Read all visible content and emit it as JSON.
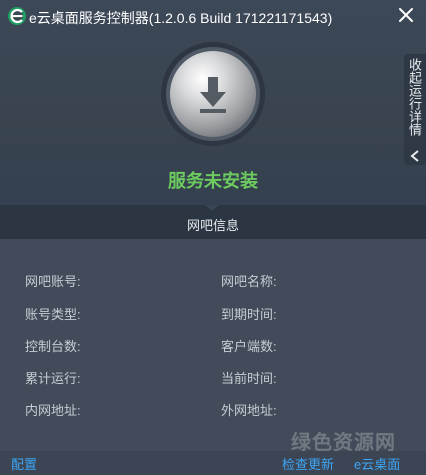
{
  "window": {
    "title": "e云桌面服务控制器(1.2.0.6 Build 171221171543)",
    "logo_icon": "e-cloud-logo-icon",
    "close_icon": "close-icon"
  },
  "side_tab": {
    "label": "收起运行详情",
    "arrow_icon": "chevron-left-icon"
  },
  "install_button": {
    "icon": "download-arrow-icon"
  },
  "status": {
    "text": "服务未安装",
    "color": "#6ccb5f"
  },
  "netbar_section": {
    "title": "网吧信息"
  },
  "fields": {
    "left": [
      {
        "label": "网吧账号:",
        "value": ""
      },
      {
        "label": "账号类型:",
        "value": ""
      },
      {
        "label": "控制台数:",
        "value": ""
      },
      {
        "label": "累计运行:",
        "value": ""
      },
      {
        "label": "内网地址:",
        "value": ""
      }
    ],
    "right": [
      {
        "label": "网吧名称:",
        "value": ""
      },
      {
        "label": "到期时间:",
        "value": ""
      },
      {
        "label": "客户端数:",
        "value": ""
      },
      {
        "label": "当前时间:",
        "value": ""
      },
      {
        "label": "外网地址:",
        "value": ""
      }
    ]
  },
  "watermark": {
    "text": "绿色资源网"
  },
  "footer": {
    "config_label": "配置",
    "check_update_label": "检查更新",
    "ecloud_label": "e云桌面",
    "link_color": "#3ca6f5"
  }
}
